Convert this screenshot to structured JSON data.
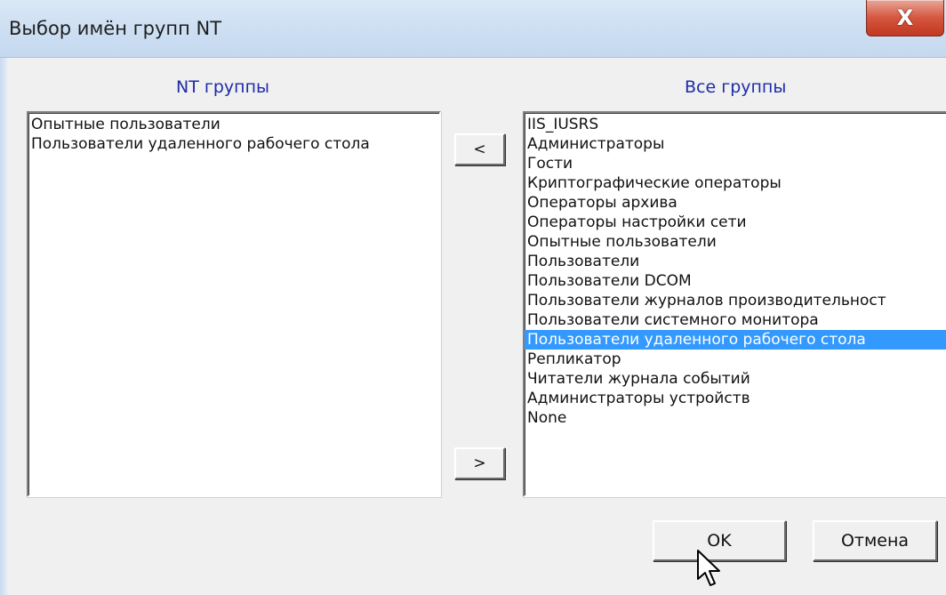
{
  "window": {
    "title": "Выбор имён групп NT",
    "close_symbol": "X"
  },
  "left_panel": {
    "header": "NT группы",
    "items": [
      "Опытные пользователи",
      "Пользователи удаленного рабочего стола"
    ]
  },
  "right_panel": {
    "header": "Все группы",
    "selected_index": 11,
    "items": [
      "IIS_IUSRS",
      "Администраторы",
      "Гости",
      "Криптографические операторы",
      "Операторы архива",
      "Операторы настройки сети",
      "Опытные пользователи",
      "Пользователи",
      "Пользователи DCOM",
      "Пользователи журналов производительност",
      "Пользователи системного монитора",
      "Пользователи удаленного рабочего стола",
      "Репликатор",
      "Читатели журнала событий",
      "Администраторы устройств",
      "None"
    ]
  },
  "buttons": {
    "move_left": "<",
    "move_right": ">",
    "ok": "OK",
    "cancel": "Отмена"
  },
  "colors": {
    "header_text": "#1e2ca8",
    "selection": "#3399ff",
    "close_button": "#d5563e"
  },
  "icons": {
    "close": "close-icon",
    "cursor": "arrow-cursor-icon"
  }
}
